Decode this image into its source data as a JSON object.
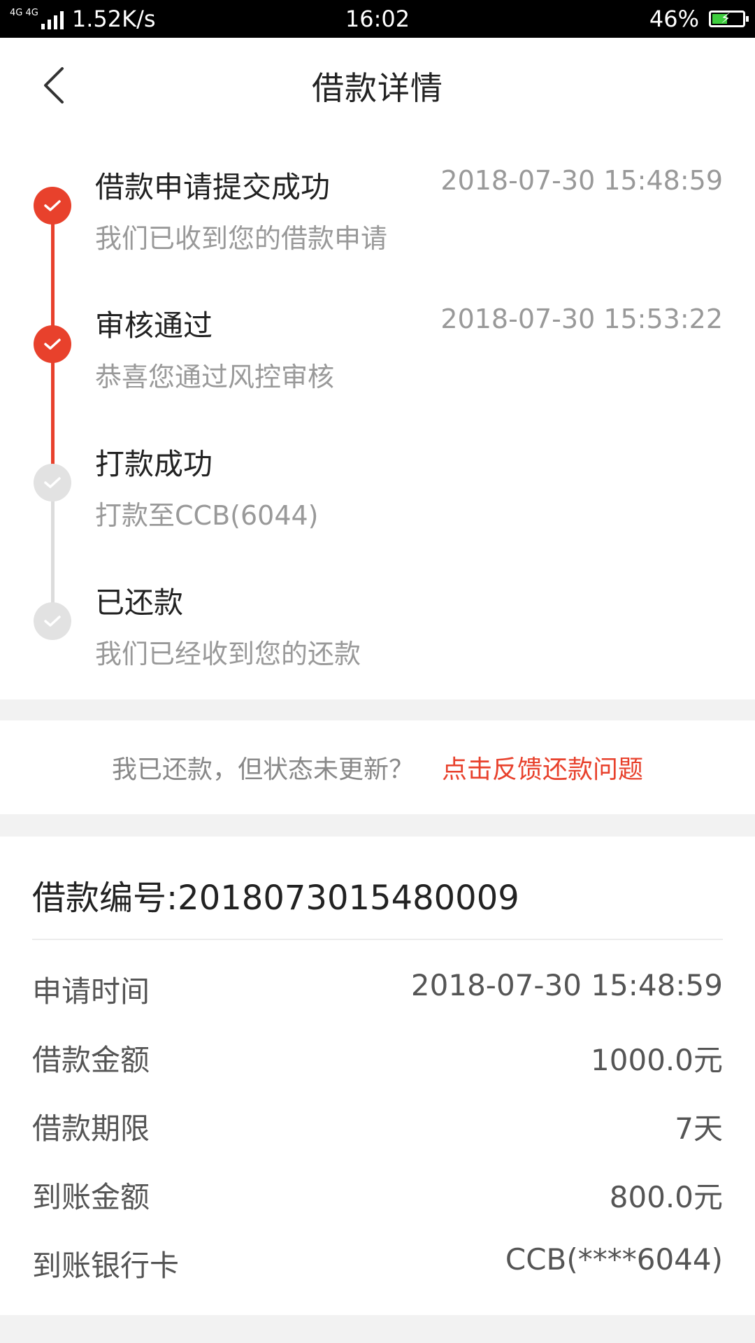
{
  "status_bar": {
    "network": "4G 4G",
    "speed": "1.52K/s",
    "time": "16:02",
    "battery": "46%"
  },
  "nav": {
    "title": "借款详情",
    "back_icon": "chevron-left-icon"
  },
  "timeline": [
    {
      "title": "借款申请提交成功",
      "time": "2018-07-30 15:48:59",
      "desc": "我们已收到您的借款申请",
      "done": true
    },
    {
      "title": "审核通过",
      "time": "2018-07-30 15:53:22",
      "desc": "恭喜您通过风控审核",
      "done": true
    },
    {
      "title": "打款成功",
      "time": "",
      "desc": "打款至CCB(6044)",
      "done": false
    },
    {
      "title": "已还款",
      "time": "",
      "desc": "我们已经收到您的还款",
      "done": false
    }
  ],
  "feedback": {
    "question": "我已还款，但状态未更新？",
    "link": "点击反馈还款问题"
  },
  "details": {
    "loan_number": "借款编号:2018073015480009",
    "rows": [
      {
        "label": "申请时间",
        "value": "2018-07-30 15:48:59"
      },
      {
        "label": "借款金额",
        "value": "1000.0元"
      },
      {
        "label": "借款期限",
        "value": "7天"
      },
      {
        "label": "到账金额",
        "value": "800.0元"
      },
      {
        "label": "到账银行卡",
        "value": "CCB(****6044)"
      }
    ]
  },
  "colors": {
    "accent": "#e8412c",
    "pending": "#e2e2e2",
    "background": "#f2f2f2"
  }
}
